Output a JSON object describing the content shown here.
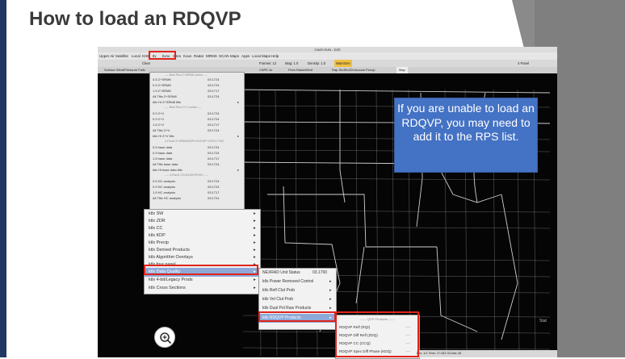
{
  "slide": {
    "title": "How to load an RDQVP",
    "callout_text": "If you are unable to load an RDQVP, you may need to add it to the RPS list."
  },
  "app": {
    "window_title": "CAVE:OUN - D2D",
    "menubar": [
      "Upper Air",
      "Satellite",
      "Local",
      "KHB",
      "tlx",
      "kvnx",
      "Sites",
      "Koun",
      "Radar",
      "MRMS",
      "SCAN",
      "Maps",
      "Apps",
      "Local Maps",
      "Help"
    ],
    "highlighted_menu": "tlx",
    "toolbar": {
      "clear_label": "Clear",
      "frames_label": "Frames: 12",
      "mag_label": "Mag: 1.0",
      "density_label": "Density: 1.0",
      "warngen_label": "WarnGen",
      "layout_label": "4 Panel"
    },
    "tabs": [
      "Surface Wind/Pressure Falls",
      "CAPE 4z",
      "Fires RadarWind",
      "Rap ShdRcS2hrAccum Precip",
      "Map"
    ],
    "menu_tlx": {
      "rows": [
        {
          "label": "0.5 Z+SRM8",
          "value": "03:1724"
        },
        {
          "label": "0.9 Z+SRM8",
          "value": "03:1724"
        },
        {
          "label": "1.5 Z+SRM8",
          "value": "03:1717"
        },
        {
          "label": "All Tilts Z+SRM8",
          "value": "03:1724"
        },
        {
          "label": "ktlx Hi Z+SRM8 tilts",
          "value": ""
        },
        {
          "label": "0.5 Z+V",
          "value": "03:1724"
        },
        {
          "label": "0.9 Z+V",
          "value": "03:1724"
        },
        {
          "label": "1.5 Z+V",
          "value": "03:1717"
        },
        {
          "label": "All Tilts Z+V",
          "value": "03:1724"
        },
        {
          "label": "ktlx Hi Z+V tilts",
          "value": ""
        },
        {
          "label": "0.5 base data",
          "value": "03:1724"
        },
        {
          "label": "0.9 base data",
          "value": "03:1724"
        },
        {
          "label": "1.5 base data",
          "value": "03:1717"
        },
        {
          "label": "All Tilts base data",
          "value": "03:1724"
        },
        {
          "label": "ktlx Hi base data tilts",
          "value": ""
        },
        {
          "label": "0.5 HC analysis",
          "value": "03:1724"
        },
        {
          "label": "0.9 HC analysis",
          "value": "03:1724"
        },
        {
          "label": "1.5 HC analysis",
          "value": "03:1717"
        },
        {
          "label": "All Tilts HC analysis",
          "value": "03:1724"
        }
      ],
      "separators": [
        "---- Best Res Z+SRM8 combo ----",
        "---- Best Res Z+V combo ----",
        "4-Panel Z+SRM8/ZDR+HC/KDP+VR/CC+SW",
        "---- 4-Panel CC/Zdr/KDP/HHC ----"
      ]
    },
    "submenu_main": [
      {
        "label": "ktlx SW"
      },
      {
        "label": "ktlx ZDR"
      },
      {
        "label": "ktlx CC"
      },
      {
        "label": "ktlx KDP"
      },
      {
        "label": "ktlx Precip"
      },
      {
        "label": "ktlx Derived Products"
      },
      {
        "label": "ktlx Algorithm Overlays"
      },
      {
        "label": "ktlx four panel"
      },
      {
        "label": "ktlx Data Quality"
      },
      {
        "label": "ktlx 4-bit/Legacy Prods"
      },
      {
        "label": "ktlx Cross Sections"
      }
    ],
    "submenu_quality": [
      {
        "label": "NEXRAD Unit Status",
        "value": "03.1700"
      },
      {
        "label": "ktlx Power Removed Control"
      },
      {
        "label": "ktlx Refl Clut Prob"
      },
      {
        "label": "ktlx Vel Clut Prob"
      },
      {
        "label": "ktlx Dual Pol Raw Products"
      },
      {
        "label": "ktlx RDQVP Products"
      }
    ],
    "submenu_rdqvp": {
      "header": "------ QVP Products ------",
      "items": [
        {
          "label": "RDQVP Refl (RQI)",
          "value": "----"
        },
        {
          "label": "RDQVP Diff Refl (ZDQ)",
          "value": "----"
        },
        {
          "label": "RDQVP CC (CCQ)",
          "value": "----"
        },
        {
          "label": "RDQVP Spec Diff Phase (KDQ)",
          "value": "----"
        }
      ]
    },
    "status_bar": "bns: 1/1   Time: 17:28Z 03-Mar-26",
    "corner_label": "Stat"
  },
  "colors": {
    "slide_accent": "#1f3864",
    "callout_bg": "#4472c4",
    "highlight_box": "#e0241b",
    "menu_highlight": "#8da9d8"
  }
}
